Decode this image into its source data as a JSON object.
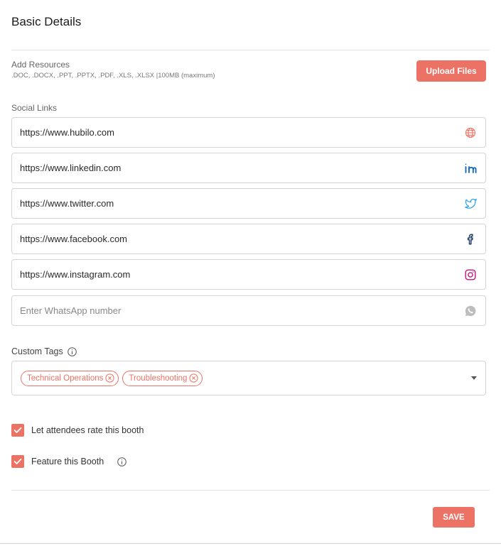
{
  "header": {
    "title": "Basic Details"
  },
  "resources": {
    "label": "Add Resources",
    "hint": ".DOC, .DOCX, .PPT, .PPTX, .PDF, .XLS, .XLSX |100MB (maximum)",
    "upload_label": "Upload Files"
  },
  "social": {
    "label": "Social Links",
    "website": {
      "value": "https://www.hubilo.com",
      "icon": "globe-icon",
      "color": "#ec7265"
    },
    "linkedin": {
      "value": "https://www.linkedin.com",
      "icon": "linkedin-icon",
      "color": "#0a66c2"
    },
    "twitter": {
      "value": "https://www.twitter.com",
      "icon": "twitter-icon",
      "color": "#1da1f2"
    },
    "facebook": {
      "value": "https://www.facebook.com",
      "icon": "facebook-icon",
      "color": "#1f3a63"
    },
    "instagram": {
      "value": "https://www.instagram.com",
      "icon": "instagram-icon",
      "color": "#c1157f"
    },
    "whatsapp": {
      "value": "",
      "placeholder": "Enter WhatsApp number",
      "icon": "whatsapp-icon",
      "color": "#bdbdbd"
    }
  },
  "tags": {
    "label": "Custom Tags",
    "items": [
      "Technical Operations",
      "Troubleshooting"
    ]
  },
  "options": {
    "rate_label": "Let attendees rate this booth",
    "rate_checked": true,
    "feature_label": "Feature this Booth",
    "feature_checked": true
  },
  "footer": {
    "save_label": "SAVE"
  },
  "colors": {
    "accent": "#ec7265",
    "border": "#d4d4d4"
  }
}
